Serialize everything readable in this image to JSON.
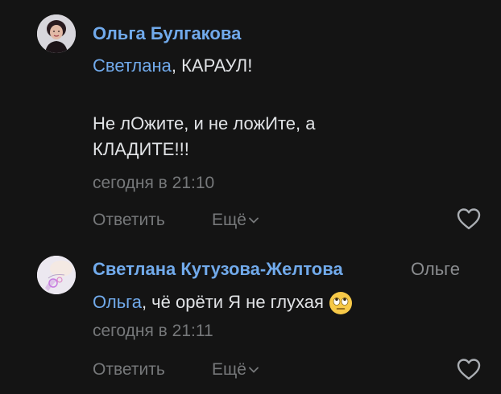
{
  "comments": [
    {
      "author": "Ольга Булгакова",
      "mention": "Светлана",
      "line1_rest": ", КАРАУЛ!",
      "line3": "Не лОжите, и не ложИте, а",
      "line4": "КЛАДИТЕ!!!",
      "date": "сегодня в 21:10",
      "reply_label": "Ответить",
      "more_label": "Ещё",
      "avatar_icon": "user-photo-avatar",
      "like_icon": "heart-outline-icon"
    },
    {
      "author": "Светлана Кутузова-Желтова",
      "reply_to": "Ольге",
      "mention": "Ольга",
      "line1_rest": ", чё орёти Я не глухая",
      "emoji_icon": "rolling-eyes-emoji",
      "date": "сегодня в 21:11",
      "reply_label": "Ответить",
      "more_label": "Ещё",
      "avatar_icon": "user-photo-avatar",
      "like_icon": "heart-outline-icon"
    }
  ],
  "colors": {
    "background": "#141414",
    "link": "#71aaeb",
    "text": "#e1e3e6",
    "secondary": "#76787a"
  }
}
